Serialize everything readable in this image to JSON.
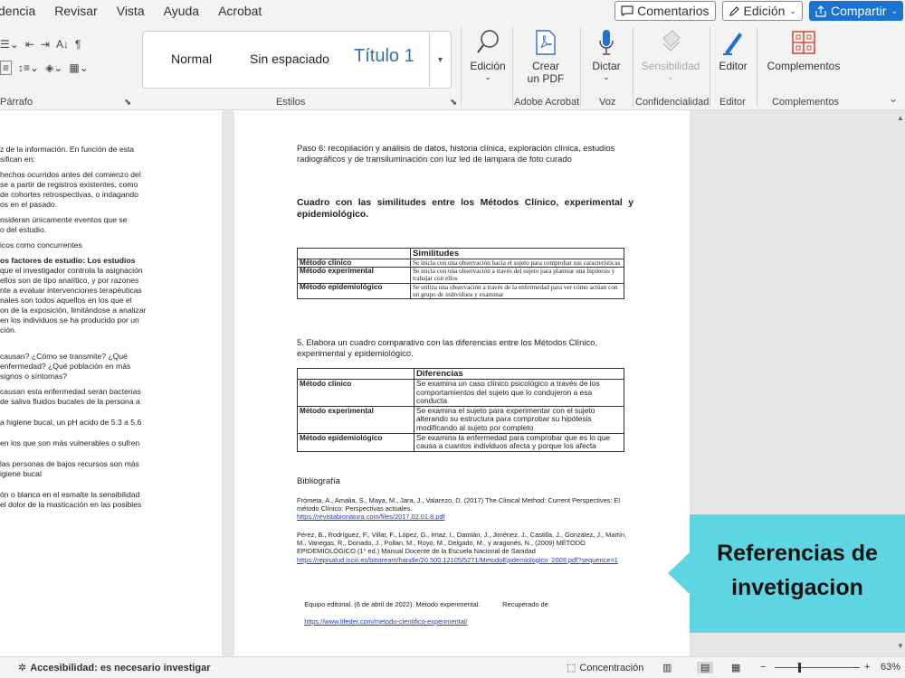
{
  "menu": {
    "tabs": [
      "dencia",
      "Revisar",
      "Vista",
      "Ayuda",
      "Acrobat"
    ],
    "comments_label": "Comentarios",
    "editing_label": "Edición",
    "share_label": "Compartir"
  },
  "ribbon": {
    "paragraph_label": "Párrafo",
    "styles": {
      "normal": "Normal",
      "no_spacing": "Sin espaciado",
      "title1": "Título 1",
      "label": "Estilos"
    },
    "edicion": "Edición",
    "crear_pdf": [
      "Crear",
      "un PDF"
    ],
    "dictar": "Dictar",
    "sensibilidad": "Sensibilidad",
    "editor": "Editor",
    "complementos": "Complementos",
    "group_labels": {
      "adobe": "Adobe Acrobat",
      "voz": "Voz",
      "confidencialidad": "Confidencialidad",
      "editor": "Editor",
      "complementos": "Complementos"
    }
  },
  "left_page_lines": [
    "z de la información. En función de esta",
    "sifican en:",
    "",
    "hechos ocurridos antes del comienzo del",
    "se a partir de registros existentes, como",
    "de cohortes retrospectivas, o indagando",
    "os en el pasado.",
    "",
    "nsideran únicamente eventos que se",
    "o del estudio.",
    "",
    "icos como concurrentes",
    "",
    "os factores de estudio: Los estudios",
    "que el investigador controla la asignación",
    "ellos son de tipo analítico, y por razones",
    "nte a evaluar intervenciones terapéuticas",
    "nales son todos aquellos en los que el",
    "on de la exposición, limitándose a analizar",
    "en los individuos se ha producido por un",
    "ción.",
    "",
    "",
    "",
    "causan? ¿Cómo se transmite? ¿Qué",
    "enfermedad? ¿Qué población en más",
    "signos o síntomas?",
    "",
    "causan esta enfermedad serán bacterias",
    "de saliva fluidos bucales de la persona a",
    "",
    "",
    "a higiene bucal, un pH acido de 5.3 a 5.6",
    "",
    "",
    "en los que son más vulnerables o sufren",
    "",
    "",
    "las personas de bajos recursos son más",
    "igiene bucal",
    "",
    "",
    "ón o blanca en el esmalte la sensibilidad",
    "el dolor de la masticación en las posibles"
  ],
  "doc": {
    "paso6": "Paso 6:  recopilación y análisis de datos, historia clínica, exploración clínica, estudios radiográficos y de transiluminación con luz led de lampara de foto curado",
    "cuadro_title": "Cuadro con las similitudes entre los Métodos Clínico, experimental y epidemiológico.",
    "table1": {
      "header": "Similitudes",
      "rows": [
        {
          "method": "Método clínico",
          "text": "Se inicia con una observación hacia el sujeto para comprobar sus características"
        },
        {
          "method": "Método experimental",
          "text": "Se inicia con una observación a través del sujeto para plantear una hipótesis y trabajar con ellos"
        },
        {
          "method": "Método epidemiológico",
          "text": "Se utiliza una observación a través de la enfermedad para ver cómo actúan con un grupo de individuos y examinar"
        }
      ]
    },
    "item5": "5. Elabora un cuadro comparativo con las diferencias entre los Métodos Clínico, experimental y epidemiológico.",
    "table2": {
      "header": "Diferencias",
      "rows": [
        {
          "method": "Método clínico",
          "text": "Se examina un caso clínico psicológico a través de los comportamientos del sujeto que lo condujeron a esa conducta"
        },
        {
          "method": "Método experimental",
          "text": "Se examina el sujeto para experimentar con el sujeto alterando su estructura para comprobar su hipótesis modificando al sujeto por completo"
        },
        {
          "method": "Método epidemiológico",
          "text": "Se examina la enfermedad para comprobar que es lo que causa a cuantos individuos afecta y porque los afecta"
        }
      ]
    },
    "bibliografia": "Bibliografía",
    "refs": [
      {
        "text": "Frómeta, A., Amalia, S., Maya, M., Jara, J., Valarezo, D. (2017) The Clinical Method: Current Perspectives: El método Clínico: Perspectivas actuales.",
        "url": "https://revistabionatura.com/files/2017.02.01.8.pdf"
      },
      {
        "text": "Pérez, B., Rodríguez, F., Villar, F., López, G.,  Imaz, I., Damián, J., Jiménez, J., Castilla, J., González, J., Martín, M., Vanegas, R., Donado, J., Pollan, M., Royo, M., Delgado, M., y aragonés, N., (2009)  MÉTODO EPIDEMIOLÓGICO (1° ed.) Manual Docente de la Escuela Nacional de Sanidad",
        "url": "https://repisalud.isciii.es/bitstream/handle/20.500.12105/5271/MetodoEpidemiologico_2009.pdf?sequence=1"
      },
      {
        "text": "Equipo editorial. (6 de abril de 2022). Método experimental.            Recuperado de",
        "url": "https://www.lifeder.com/metodo-cientifico-experimental/"
      }
    ]
  },
  "callout": {
    "line1": "Referencias de",
    "line2": "invetigacion",
    "color": "#5ed5e2"
  },
  "status": {
    "accessibility": "Accesibilidad: es necesario investigar",
    "focus": "Concentración",
    "zoom_minus": "−",
    "zoom_plus": "+",
    "zoom": "63%"
  },
  "colors": {
    "accent": "#1a73d1",
    "title_style": "#2e74b5",
    "link": "#1a3cc7"
  }
}
